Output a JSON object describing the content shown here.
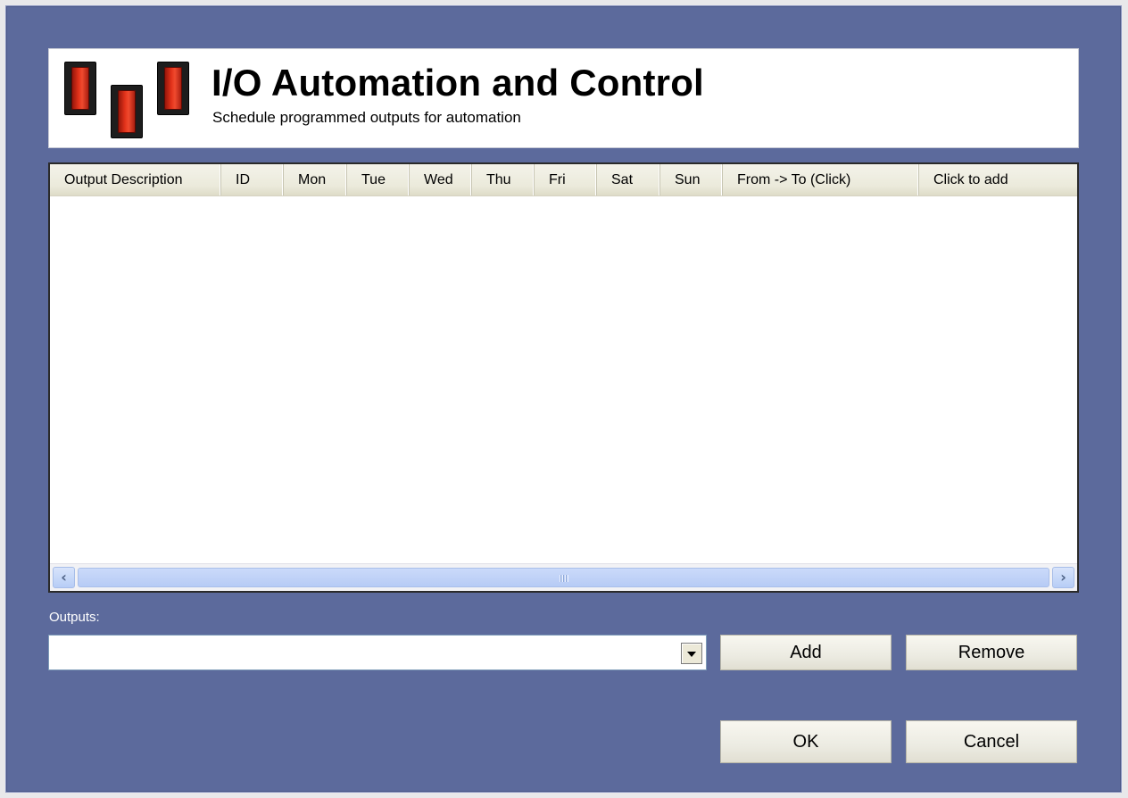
{
  "header": {
    "title": "I/O Automation and Control",
    "subtitle": "Schedule programmed outputs for automation",
    "logo_icon": "rocker-switches-icon",
    "accent_color": "#e2321a"
  },
  "schedule_table": {
    "columns": [
      "Output Description",
      "ID",
      "Mon",
      "Tue",
      "Wed",
      "Thu",
      "Fri",
      "Sat",
      "Sun",
      "From -> To (Click)",
      "Click to add"
    ],
    "rows": []
  },
  "outputs": {
    "label": "Outputs:",
    "selected_value": ""
  },
  "buttons": {
    "add": "Add",
    "remove": "Remove",
    "ok": "OK",
    "cancel": "Cancel"
  },
  "icons": {
    "scroll_left": "‹",
    "scroll_right": "›"
  },
  "colors": {
    "dialog_background": "#5c6a9c",
    "header_background": "#ffffff"
  }
}
